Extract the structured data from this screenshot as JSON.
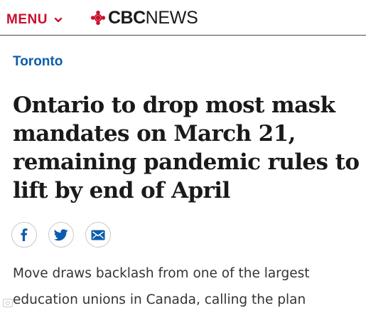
{
  "header": {
    "menu_label": "MENU",
    "logo_cbc": "CBC",
    "logo_news": "NEWS",
    "brand_color": "#c8102e"
  },
  "article": {
    "section": "Toronto",
    "headline": "Ontario to drop most mask mandates on March 21, remaining pandemic rules to lift by end of April",
    "deck": "Move draws backlash from one of the largest education unions in Canada, calling the plan"
  },
  "share": {
    "icons": [
      "facebook-icon",
      "twitter-icon",
      "email-icon"
    ],
    "icon_color": "#0b5cad"
  },
  "colors": {
    "link": "#0b5cad",
    "text": "#1a1a1a",
    "deck_text": "#333333",
    "menu": "#c8102e"
  }
}
